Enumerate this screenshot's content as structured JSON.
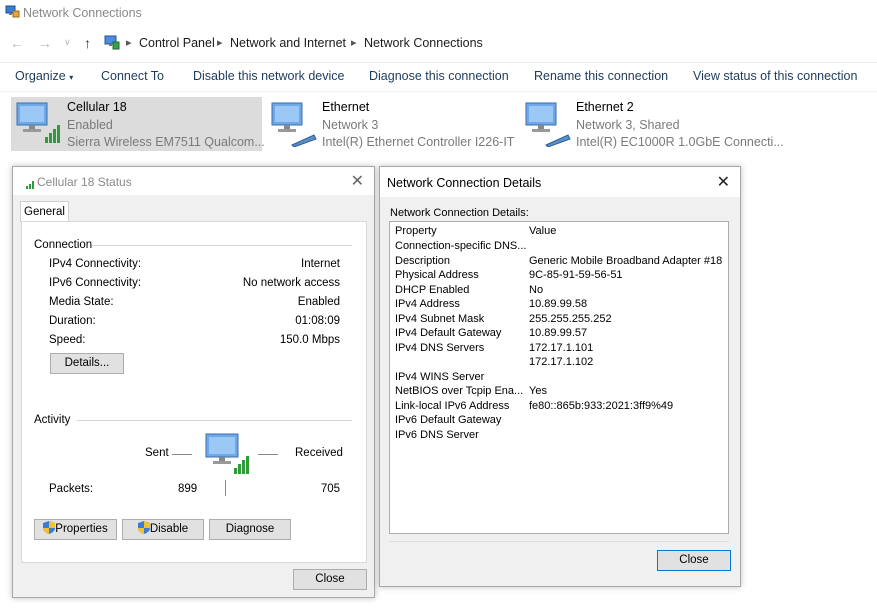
{
  "window": {
    "title": "Network Connections"
  },
  "address": {
    "crumbs": [
      "Control Panel",
      "Network and Internet",
      "Network Connections"
    ]
  },
  "command_bar": {
    "organize": "Organize",
    "connect_to": "Connect To",
    "disable": "Disable this network device",
    "diagnose": "Diagnose this connection",
    "rename": "Rename this connection",
    "view_status": "View status of this connection"
  },
  "connections": [
    {
      "name": "Cellular 18",
      "line2": "Enabled",
      "line3": "Sierra Wireless EM7511 Qualcom..."
    },
    {
      "name": "Ethernet",
      "line2": "Network 3",
      "line3": "Intel(R) Ethernet Controller I226-IT"
    },
    {
      "name": "Ethernet 2",
      "line2": "Network 3, Shared",
      "line3": "Intel(R) EC1000R 1.0GbE Connecti..."
    }
  ],
  "status_dialog": {
    "title": "Cellular 18 Status",
    "tab": "General",
    "connection_label": "Connection",
    "rows": [
      {
        "k": "IPv4 Connectivity:",
        "v": "Internet"
      },
      {
        "k": "IPv6 Connectivity:",
        "v": "No network access"
      },
      {
        "k": "Media State:",
        "v": "Enabled"
      },
      {
        "k": "Duration:",
        "v": "01:08:09"
      },
      {
        "k": "Speed:",
        "v": "150.0 Mbps"
      }
    ],
    "details_button": "Details...",
    "activity_label": "Activity",
    "sent_label": "Sent",
    "received_label": "Received",
    "packets_label": "Packets:",
    "packets_sent": "899",
    "packets_received": "705",
    "properties_button": "Properties",
    "disable_button": "Disable",
    "diagnose_button": "Diagnose",
    "close_button": "Close"
  },
  "details_dialog": {
    "title": "Network Connection Details",
    "list_label": "Network Connection Details:",
    "header_property": "Property",
    "header_value": "Value",
    "rows": [
      {
        "p": "Connection-specific DNS...",
        "v": ""
      },
      {
        "p": "Description",
        "v": "Generic Mobile Broadband Adapter #18"
      },
      {
        "p": "Physical Address",
        "v": "9C-85-91-59-56-51"
      },
      {
        "p": "DHCP Enabled",
        "v": "No"
      },
      {
        "p": "IPv4 Address",
        "v": "10.89.99.58"
      },
      {
        "p": "IPv4 Subnet Mask",
        "v": "255.255.255.252"
      },
      {
        "p": "IPv4 Default Gateway",
        "v": "10.89.99.57"
      },
      {
        "p": "IPv4 DNS Servers",
        "v": "172.17.1.101"
      },
      {
        "p": "",
        "v": "172.17.1.102"
      },
      {
        "p": "IPv4 WINS Server",
        "v": ""
      },
      {
        "p": "NetBIOS over Tcpip Ena...",
        "v": "Yes"
      },
      {
        "p": "Link-local IPv6 Address",
        "v": "fe80::865b:933:2021:3ff9%49"
      },
      {
        "p": "IPv6 Default Gateway",
        "v": ""
      },
      {
        "p": "IPv6 DNS Server",
        "v": ""
      }
    ],
    "close_button": "Close"
  }
}
